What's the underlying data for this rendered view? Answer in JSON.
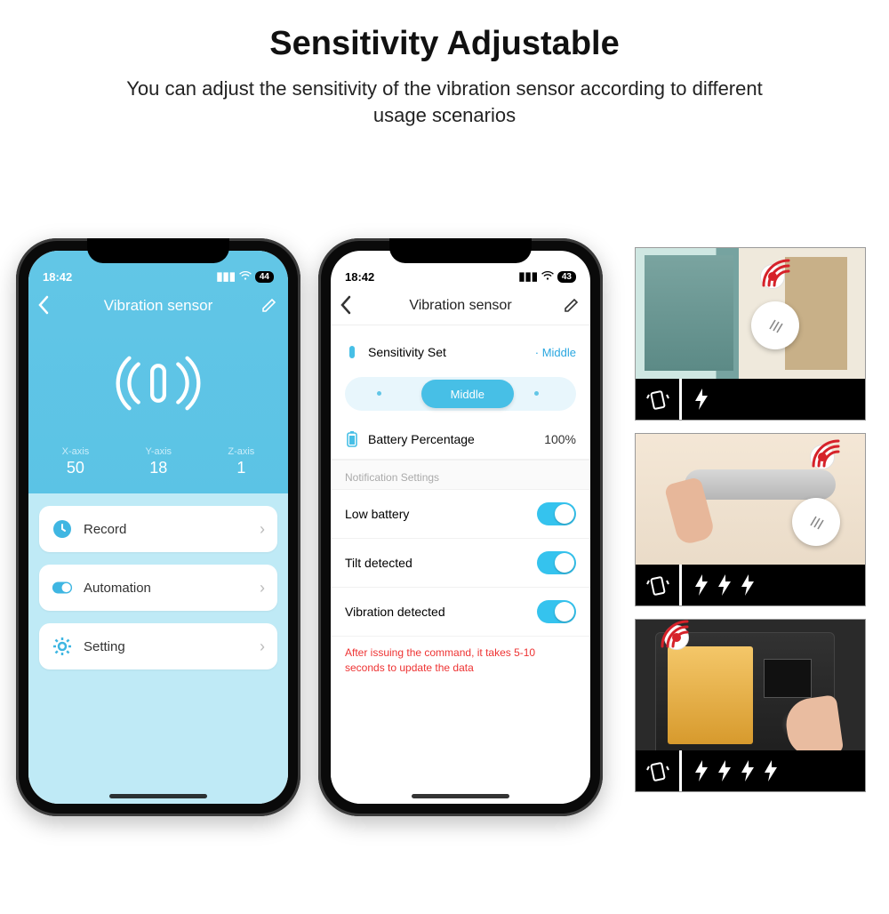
{
  "headline": "Sensitivity Adjustable",
  "subhead": "You can adjust the sensitivity of the vibration sensor according to different usage scenarios",
  "status": {
    "time1": "18:42",
    "time2": "18:42",
    "batt1": "44",
    "batt2": "43"
  },
  "phone1": {
    "title": "Vibration sensor",
    "axes": [
      {
        "label": "X-axis",
        "value": "50"
      },
      {
        "label": "Y-axis",
        "value": "18"
      },
      {
        "label": "Z-axis",
        "value": "1"
      }
    ],
    "items": {
      "record": "Record",
      "automation": "Automation",
      "setting": "Setting"
    }
  },
  "phone2": {
    "title": "Vibration sensor",
    "sens_label": "Sensitivity Set",
    "sens_value": "Middle",
    "seg_selected": "Middle",
    "battery_label": "Battery Percentage",
    "battery_value": "100%",
    "section": "Notification Settings",
    "rows": {
      "low": "Low battery",
      "tilt": "Tilt detected",
      "vib": "Vibration detected"
    },
    "warn": "After issuing the command, it takes 5-10 seconds to update the data"
  },
  "tiles": {
    "bolts": [
      1,
      3,
      4
    ]
  }
}
